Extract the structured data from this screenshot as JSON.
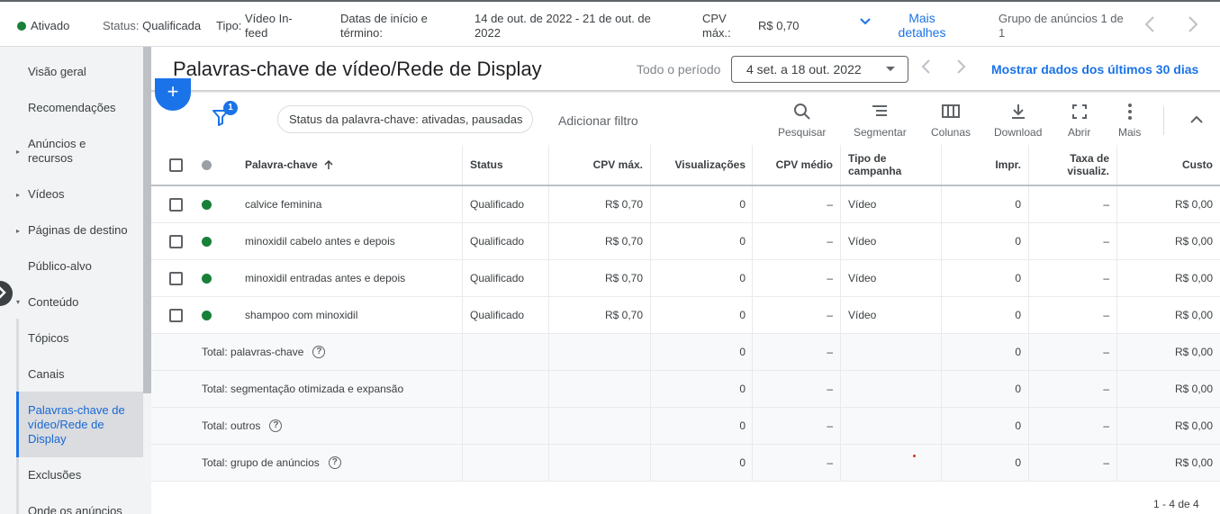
{
  "summary": {
    "status_value": "Ativado",
    "status_label": "Status:",
    "status_text": "Qualificada",
    "type_label": "Tipo:",
    "type_value_line1": "Vídeo In-",
    "type_value_line2": "feed",
    "dates_label_line1": "Datas de início e",
    "dates_label_line2": "término:",
    "dates_value_line1": "14 de out. de 2022 - 21 de out. de",
    "dates_value_line2": "2022",
    "cpv_label_line1": "CPV",
    "cpv_label_line2": "máx.:",
    "cpv_value": "R$ 0,70",
    "more_details_line1": "Mais",
    "more_details_line2": "detalhes",
    "adgroup_line1": "Grupo de anúncios 1 de",
    "adgroup_line2": "1"
  },
  "sidebar": {
    "items": [
      {
        "label": "Visão geral"
      },
      {
        "label": "Recomendações"
      },
      {
        "label_line1": "Anúncios e",
        "label_line2": "recursos"
      },
      {
        "label": "Vídeos"
      },
      {
        "label": "Páginas de destino"
      },
      {
        "label": "Público-alvo"
      },
      {
        "label": "Conteúdo"
      },
      {
        "label": "Tópicos"
      },
      {
        "label": "Canais"
      },
      {
        "label_line1": "Palavras-chave de",
        "label_line2": "vídeo/Rede de",
        "label_line3": "Display"
      },
      {
        "label": "Exclusões"
      },
      {
        "label": "Onde os anúncios"
      }
    ]
  },
  "header": {
    "title": "Palavras-chave de vídeo/Rede de Display",
    "period_label": "Todo o período",
    "date_range": "4 set. a 18 out. 2022",
    "last30_link": "Mostrar dados dos últimos 30 dias"
  },
  "toolbar": {
    "fab_label": "+",
    "filter_count": "1",
    "status_chip": "Status da palavra-chave: ativadas, pausadas",
    "add_filter": "Adicionar filtro",
    "tools": [
      {
        "label": "Pesquisar",
        "icon": "search-icon"
      },
      {
        "label": "Segmentar",
        "icon": "segment-icon"
      },
      {
        "label": "Colunas",
        "icon": "columns-icon"
      },
      {
        "label": "Download",
        "icon": "download-icon"
      },
      {
        "label": "Abrir",
        "icon": "fullscreen-icon"
      },
      {
        "label": "Mais",
        "icon": "more-vert-icon"
      }
    ]
  },
  "table": {
    "columns": {
      "keyword": "Palavra-chave",
      "status": "Status",
      "max_cpv": "CPV máx.",
      "views": "Visualizações",
      "avg_cpv": "CPV médio",
      "campaign_type_line1": "Tipo de",
      "campaign_type_line2": "campanha",
      "impr": "Impr.",
      "view_rate_line1": "Taxa de",
      "view_rate_line2": "visualiz.",
      "cost": "Custo"
    },
    "rows": [
      {
        "keyword": "calvice feminina",
        "status": "Qualificado",
        "max_cpv": "R$ 0,70",
        "views": "0",
        "avg_cpv": "–",
        "campaign_type": "Vídeo",
        "impr": "0",
        "view_rate": "–",
        "cost": "R$ 0,00"
      },
      {
        "keyword": "minoxidil cabelo antes e depois",
        "status": "Qualificado",
        "max_cpv": "R$ 0,70",
        "views": "0",
        "avg_cpv": "–",
        "campaign_type": "Vídeo",
        "impr": "0",
        "view_rate": "–",
        "cost": "R$ 0,00"
      },
      {
        "keyword": "minoxidil entradas antes e depois",
        "status": "Qualificado",
        "max_cpv": "R$ 0,70",
        "views": "0",
        "avg_cpv": "–",
        "campaign_type": "Vídeo",
        "impr": "0",
        "view_rate": "–",
        "cost": "R$ 0,00"
      },
      {
        "keyword": "shampoo com minoxidil",
        "status": "Qualificado",
        "max_cpv": "R$ 0,70",
        "views": "0",
        "avg_cpv": "–",
        "campaign_type": "Vídeo",
        "impr": "0",
        "view_rate": "–",
        "cost": "R$ 0,00"
      }
    ],
    "totals": [
      {
        "label": "Total: palavras-chave",
        "help": true,
        "views": "0",
        "avg_cpv": "–",
        "impr": "0",
        "view_rate": "–",
        "cost": "R$ 0,00"
      },
      {
        "label": "Total: segmentação otimizada e expansão",
        "help": false,
        "views": "0",
        "avg_cpv": "–",
        "impr": "0",
        "view_rate": "–",
        "cost": "R$ 0,00"
      },
      {
        "label": "Total: outros",
        "help": true,
        "views": "0",
        "avg_cpv": "–",
        "impr": "0",
        "view_rate": "–",
        "cost": "R$ 0,00"
      },
      {
        "label": "Total: grupo de anúncios",
        "help": true,
        "views": "0",
        "avg_cpv": "–",
        "impr": "0",
        "view_rate": "–",
        "cost": "R$ 0,00"
      }
    ],
    "pager": "1 - 4 de 4"
  },
  "colors": {
    "accent": "#1a73e8",
    "enabled_green": "#188038",
    "active_nav": "#1967d2"
  }
}
